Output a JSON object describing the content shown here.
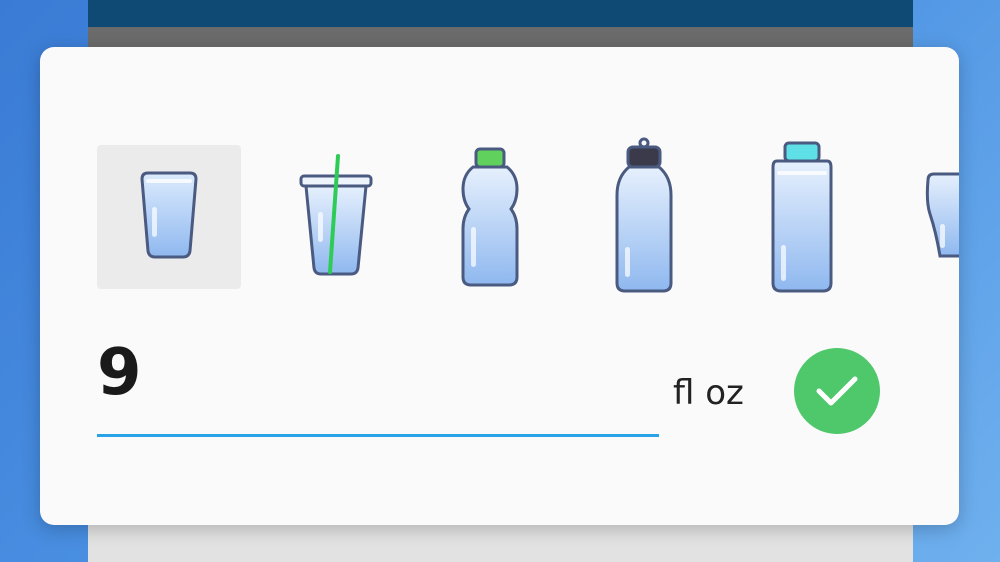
{
  "dialog": {
    "vessels": [
      {
        "name": "glass",
        "selected": true
      },
      {
        "name": "cup-with-straw",
        "selected": false
      },
      {
        "name": "bottle-green-cap",
        "selected": false
      },
      {
        "name": "sports-bottle",
        "selected": false
      },
      {
        "name": "bottle-teal-cap",
        "selected": false
      },
      {
        "name": "pitcher-partial",
        "selected": false
      }
    ],
    "amount": "9",
    "unit": "fl oz"
  },
  "colors": {
    "accent_underline": "#29a3e8",
    "confirm": "#4fc76b",
    "water": "#a9ccf5",
    "outline": "#4a5a80",
    "green_cap": "#5fd15c",
    "teal_cap": "#5fe0e6",
    "dark_cap": "#3a3a4a"
  }
}
